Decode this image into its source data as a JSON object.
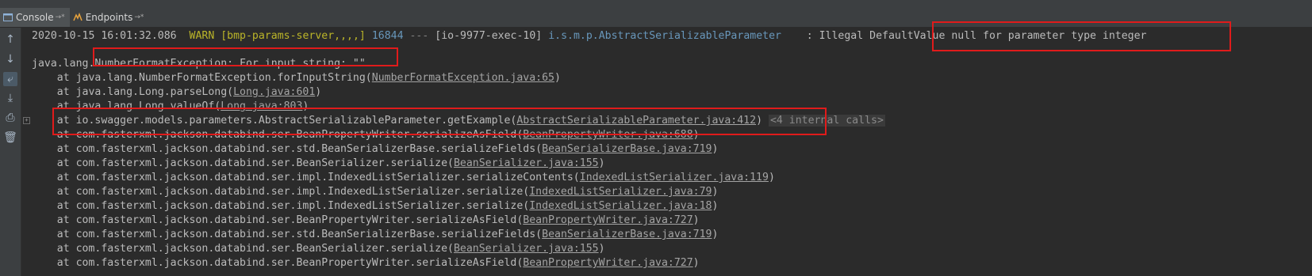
{
  "tabs": [
    {
      "label": "Console",
      "pin": "→*",
      "icon": "console-icon",
      "active": true
    },
    {
      "label": "Endpoints",
      "pin": "→*",
      "icon": "endpoints-icon",
      "active": false
    }
  ],
  "toolbar_icons": [
    "up-arrow-icon",
    "down-arrow-icon",
    "soft-wrap-icon",
    "scroll-to-end-icon",
    "print-icon",
    "trash-icon"
  ],
  "log": {
    "warn": {
      "timestamp": "2020-10-15 16:01:32.086",
      "level": "WARN",
      "app": "[bmp-params-server,,,,]",
      "pid": "16844",
      "sep": "---",
      "thread": "[io-9977-exec-10]",
      "logger": "i.s.m.p.AbstractSerializableParameter",
      "message_prefix": ": Illegal ",
      "message_highlight": "DefaultValue null for parameter type integer"
    },
    "exception": {
      "prefix": "java.lang.",
      "name": "NumberFormatException: For input string: \"\""
    },
    "frames": [
      {
        "method": "at java.lang.NumberFormatException.forInputString(",
        "src": "NumberFormatException.java:65",
        "suffix": ")"
      },
      {
        "method": "at java.lang.Long.parseLong(",
        "src": "Long.java:601",
        "suffix": ")"
      },
      {
        "method": "at java.lang.Long.valueOf(",
        "src": "Long.java:803",
        "suffix": ")"
      },
      {
        "method": "at io.swagger.models.parameters.AbstractSerializableParameter.getExample(",
        "src": "AbstractSerializableParameter.java:412",
        "suffix": ")",
        "badge": "<4 internal calls>"
      },
      {
        "method": "at com.fasterxml.jackson.databind.ser.BeanPropertyWriter.serializeAsField(",
        "src": "BeanPropertyWriter.java:688",
        "suffix": ")"
      },
      {
        "method": "at com.fasterxml.jackson.databind.ser.std.BeanSerializerBase.serializeFields(",
        "src": "BeanSerializerBase.java:719",
        "suffix": ")"
      },
      {
        "method": "at com.fasterxml.jackson.databind.ser.BeanSerializer.serialize(",
        "src": "BeanSerializer.java:155",
        "suffix": ")"
      },
      {
        "method": "at com.fasterxml.jackson.databind.ser.impl.IndexedListSerializer.serializeContents(",
        "src": "IndexedListSerializer.java:119",
        "suffix": ")"
      },
      {
        "method": "at com.fasterxml.jackson.databind.ser.impl.IndexedListSerializer.serialize(",
        "src": "IndexedListSerializer.java:79",
        "suffix": ")"
      },
      {
        "method": "at com.fasterxml.jackson.databind.ser.impl.IndexedListSerializer.serialize(",
        "src": "IndexedListSerializer.java:18",
        "suffix": ")"
      },
      {
        "method": "at com.fasterxml.jackson.databind.ser.BeanPropertyWriter.serializeAsField(",
        "src": "BeanPropertyWriter.java:727",
        "suffix": ")"
      },
      {
        "method": "at com.fasterxml.jackson.databind.ser.std.BeanSerializerBase.serializeFields(",
        "src": "BeanSerializerBase.java:719",
        "suffix": ")"
      },
      {
        "method": "at com.fasterxml.jackson.databind.ser.BeanSerializer.serialize(",
        "src": "BeanSerializer.java:155",
        "suffix": ")"
      },
      {
        "method": "at com.fasterxml.jackson.databind.ser.BeanPropertyWriter.serializeAsField(",
        "src": "BeanPropertyWriter.java:727",
        "suffix": ")"
      }
    ]
  },
  "colors": {
    "background": "#2b2b2b",
    "text": "#bbbbbb",
    "warn": "#bbb529",
    "logger": "#6897bb",
    "link": "#a4a4a4",
    "highlight_box": "#e01b1b"
  }
}
